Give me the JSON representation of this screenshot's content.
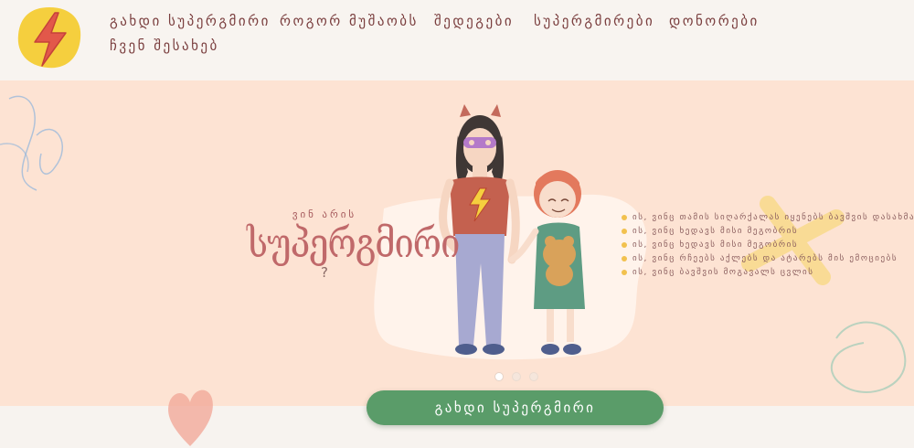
{
  "nav": {
    "items": [
      "გახდი სუპერგმირი",
      "როგორ მუშაობს",
      "შედეგები",
      "სუპერგმირები",
      "დონორები",
      "ჩვენ შესახებ"
    ]
  },
  "hero": {
    "who_small": "ვინ არის",
    "who_big": "სუპერგმირი",
    "who_q": "?",
    "bullets": [
      "ის, ვინც თამის სიღარ​ქალას იყენებს ბავშვის დასახმარებლად",
      "ის, ვინც ხედავს მისი მეგობრის",
      "ის, ვინც ხედავს მისი მეგობრის",
      "ის, ვინც რჩეებს აქლებს და ატარებს მის ემოციებს",
      "ის, ვინც ბავშვის მოგავალს ცვლის"
    ],
    "slides": 3,
    "active_slide": 1
  },
  "cta": {
    "label": "გახდი სუპერგმირი"
  },
  "colors": {
    "header_bg": "#f8f4f0",
    "hero_bg": "#fde3d3",
    "nav_text": "#7a3e3e",
    "accent_green": "#5a9c69",
    "title_red": "#c0696a",
    "bullet_yellow": "#f2c14e",
    "logo_bolt": "#e2584a",
    "logo_bg": "#f5cf3e"
  },
  "icons": {
    "logo": "lightning-bolt-icon",
    "bullet": "dot-icon"
  }
}
